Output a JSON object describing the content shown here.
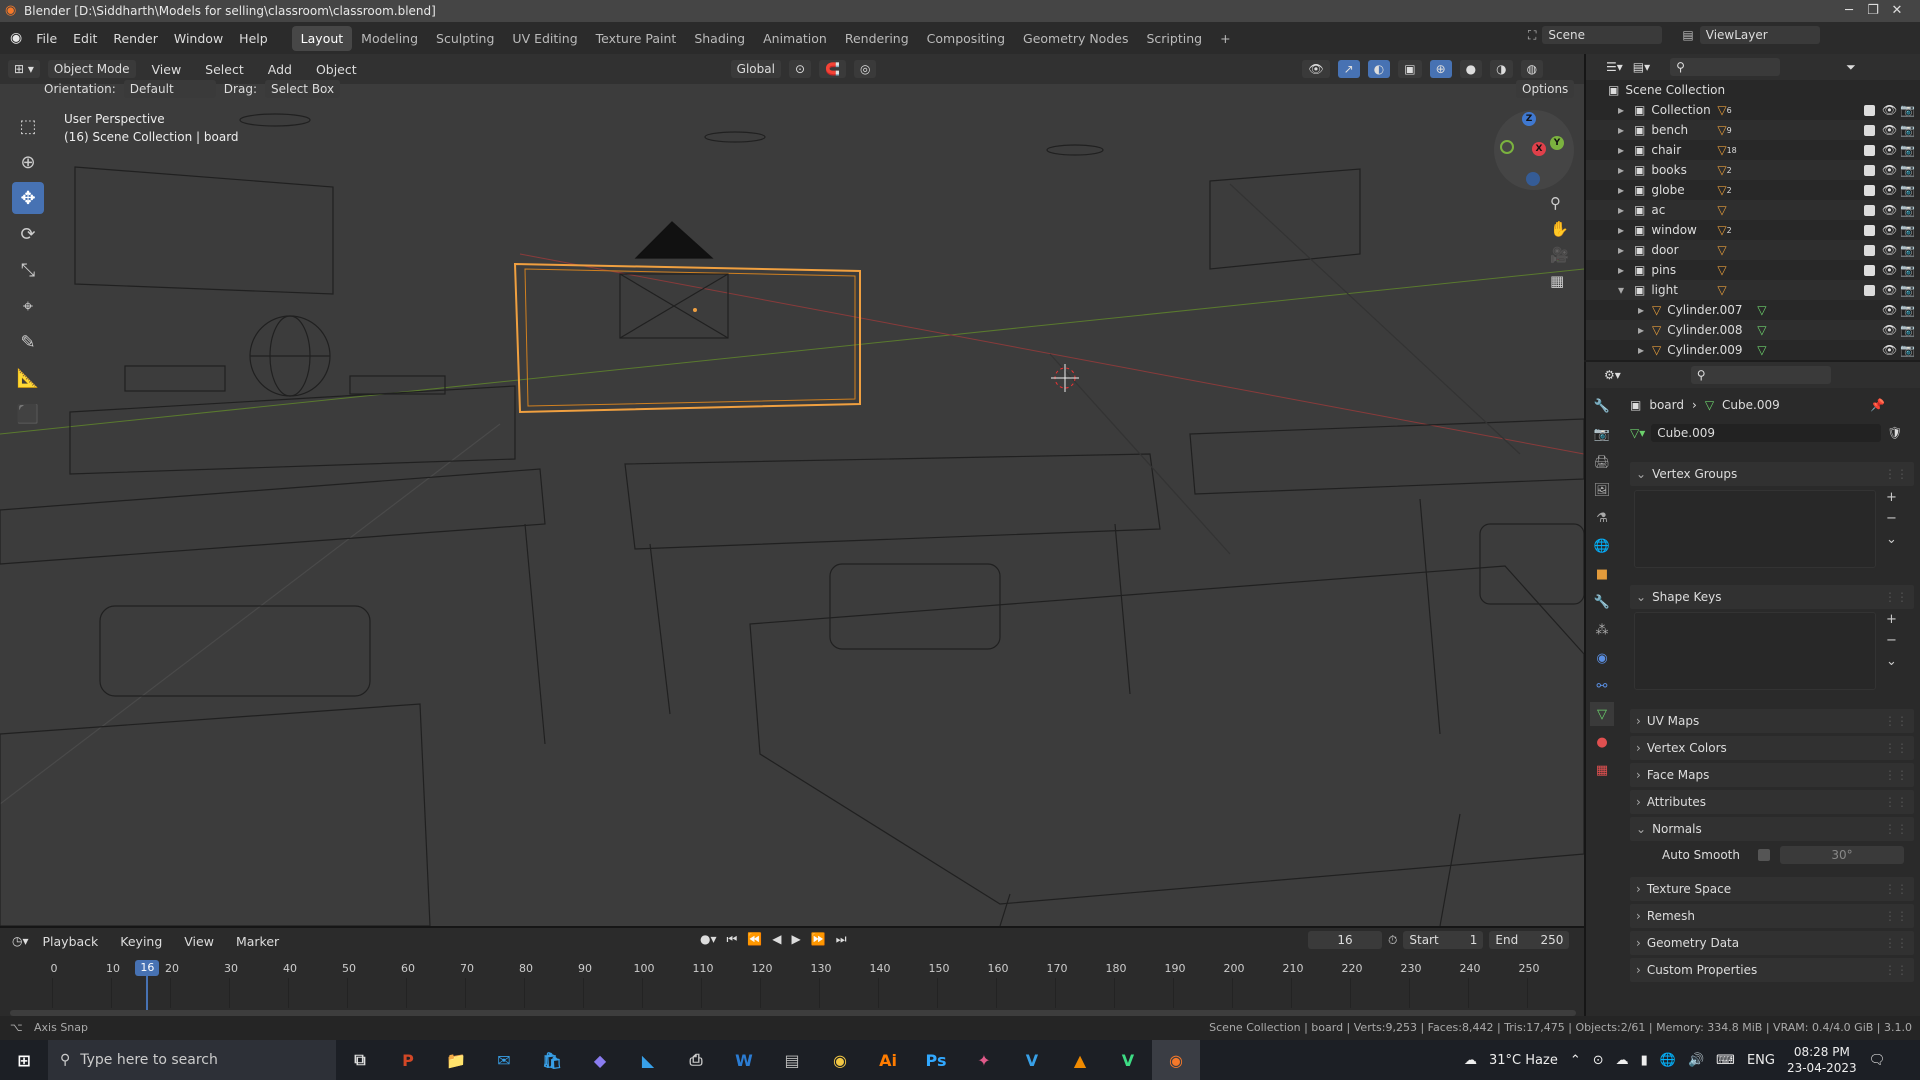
{
  "window": {
    "title": "Blender [D:\\Siddharth\\Models for selling\\classroom\\classroom.blend]",
    "min": "─",
    "max": "❐",
    "close": "✕"
  },
  "menu": [
    "File",
    "Edit",
    "Render",
    "Window",
    "Help"
  ],
  "workspaces": [
    "Layout",
    "Modeling",
    "Sculpting",
    "UV Editing",
    "Texture Paint",
    "Shading",
    "Animation",
    "Rendering",
    "Compositing",
    "Geometry Nodes",
    "Scripting",
    "+"
  ],
  "scene": {
    "label": "Scene",
    "view_layer": "ViewLayer"
  },
  "viewport_header": {
    "mode": "Object Mode",
    "menus": [
      "View",
      "Select",
      "Add",
      "Object"
    ],
    "transform": "Global",
    "options": "Options"
  },
  "tool_settings": {
    "orientation_label": "Orientation:",
    "orientation_value": "Default",
    "drag_label": "Drag:",
    "drag_value": "Select Box"
  },
  "viewport_info": {
    "line1": "User Perspective",
    "line2": "(16) Scene Collection | board"
  },
  "gizmo": {
    "z": "Z",
    "y": "Y",
    "x": "X"
  },
  "outliner": {
    "root": "Scene Collection",
    "items": [
      {
        "name": "Collection",
        "badge": "6"
      },
      {
        "name": "bench",
        "badge": "9"
      },
      {
        "name": "chair",
        "badge": "18"
      },
      {
        "name": "books",
        "badge": "2"
      },
      {
        "name": "globe",
        "badge": "2"
      },
      {
        "name": "ac",
        "badge": ""
      },
      {
        "name": "window",
        "badge": "2"
      },
      {
        "name": "door",
        "badge": ""
      },
      {
        "name": "pins",
        "badge": ""
      },
      {
        "name": "light",
        "badge": ""
      }
    ],
    "children": [
      "Cylinder.007",
      "Cylinder.008",
      "Cylinder.009"
    ]
  },
  "properties": {
    "breadcrumb_object": "board",
    "breadcrumb_mesh": "Cube.009",
    "mesh_name": "Cube.009",
    "panels_top": [
      "Vertex Groups",
      "Shape Keys"
    ],
    "panels": [
      "UV Maps",
      "Vertex Colors",
      "Face Maps",
      "Attributes",
      "Normals"
    ],
    "auto_smooth_label": "Auto Smooth",
    "auto_smooth_angle": "30°",
    "panels_bottom": [
      "Texture Space",
      "Remesh",
      "Geometry Data",
      "Custom Properties"
    ]
  },
  "timeline": {
    "menus": [
      "Playback",
      "Keying",
      "View",
      "Marker"
    ],
    "current_frame": "16",
    "start_label": "Start",
    "start": "1",
    "end_label": "End",
    "end": "250",
    "ticks": [
      "0",
      "10",
      "20",
      "30",
      "40",
      "50",
      "60",
      "70",
      "80",
      "90",
      "100",
      "110",
      "120",
      "130",
      "140",
      "150",
      "160",
      "170",
      "180",
      "190",
      "200",
      "210",
      "220",
      "230",
      "240",
      "250"
    ],
    "playhead": "16"
  },
  "status": {
    "left": "Axis Snap",
    "right": "Scene Collection | board | Verts:9,253 | Faces:8,442 | Tris:17,475 | Objects:2/61 | Memory: 334.8 MiB | VRAM: 0.4/4.0 GiB | 3.1.0"
  },
  "taskbar": {
    "search": "Type here to search",
    "weather": "31°C  Haze",
    "lang": "ENG",
    "time": "08:28 PM",
    "date": "23-04-2023"
  }
}
